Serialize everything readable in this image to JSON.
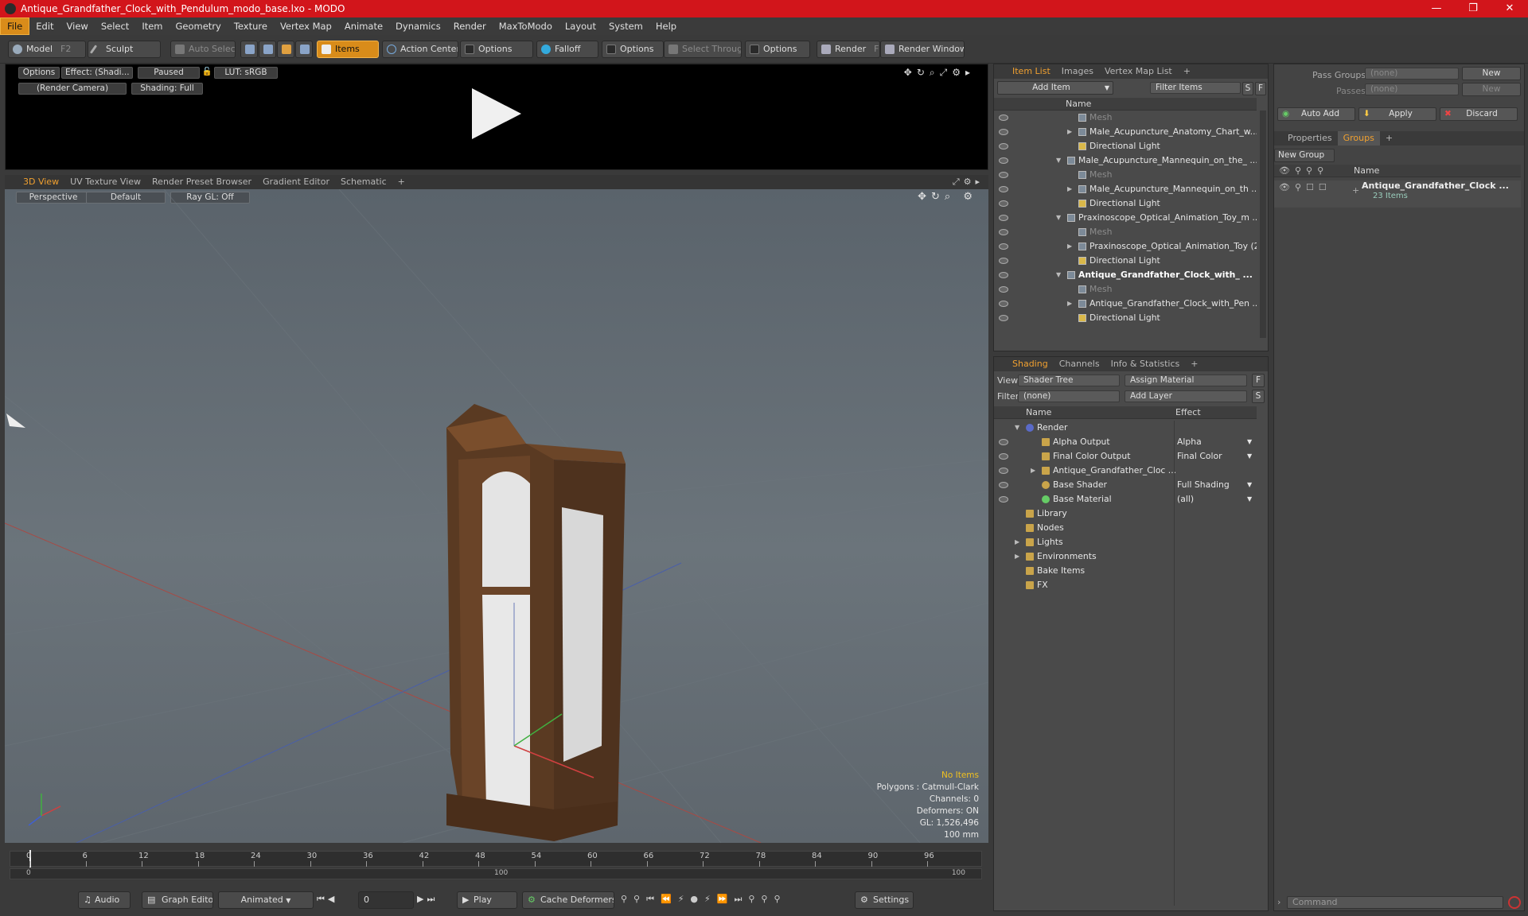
{
  "window": {
    "title": "Antique_Grandfather_Clock_with_Pendulum_modo_base.lxo - MODO"
  },
  "menu": [
    "File",
    "Edit",
    "View",
    "Select",
    "Item",
    "Geometry",
    "Texture",
    "Vertex Map",
    "Animate",
    "Dynamics",
    "Render",
    "MaxToModo",
    "Layout",
    "System",
    "Help"
  ],
  "toolbar": {
    "model": "Model",
    "model_key": "F2",
    "sculpt": "Sculpt",
    "auto_select": "Auto Select",
    "items": "Items",
    "action_center": "Action Center",
    "options1": "Options",
    "falloff": "Falloff",
    "options2": "Options",
    "select_through": "Select Through",
    "options3": "Options",
    "render": "Render",
    "render_key": "F9",
    "render_window": "Render Window"
  },
  "preview": {
    "options": "Options",
    "effect": "Effect: (Shadi...",
    "paused": "Paused",
    "lut": "LUT: sRGB",
    "camera": "(Render Camera)",
    "shading": "Shading: Full"
  },
  "viewport_tabs": [
    "3D View",
    "UV Texture View",
    "Render Preset Browser",
    "Gradient Editor",
    "Schematic",
    "+"
  ],
  "viewport": {
    "perspective": "Perspective",
    "default": "Default",
    "raygl": "Ray GL: Off",
    "stats": [
      "No Items",
      "Polygons : Catmull-Clark",
      "Channels: 0",
      "Deformers: ON",
      "GL: 1,526,496",
      "100 mm"
    ]
  },
  "timeline": {
    "ticks": [
      "0",
      "6",
      "12",
      "18",
      "24",
      "30",
      "36",
      "42",
      "48",
      "54",
      "60",
      "66",
      "72",
      "78",
      "84",
      "90",
      "96"
    ],
    "sub": [
      "0",
      "100",
      "100"
    ]
  },
  "bottom": {
    "audio": "Audio",
    "graph_editor": "Graph Editor",
    "animated": "Animated",
    "frame": "0",
    "play": "Play",
    "cache": "Cache Deformers",
    "settings": "Settings",
    "command_placeholder": "Command"
  },
  "item_list": {
    "tabs": [
      "Item List",
      "Images",
      "Vertex Map List",
      "+"
    ],
    "add_item": "Add Item",
    "filter": "Filter Items",
    "s": "S",
    "f": "F",
    "col_name": "Name",
    "rows": [
      {
        "label": "Mesh",
        "indent": 2,
        "dim": true
      },
      {
        "label": "Male_Acupuncture_Anatomy_Chart_w...",
        "indent": 2,
        "arrow": "▶"
      },
      {
        "label": "Directional Light",
        "indent": 2
      },
      {
        "label": "Male_Acupuncture_Mannequin_on_the_ ...",
        "indent": 1,
        "arrow": "▼"
      },
      {
        "label": "Mesh",
        "indent": 2,
        "dim": true
      },
      {
        "label": "Male_Acupuncture_Mannequin_on_th ...",
        "indent": 2,
        "arrow": "▶"
      },
      {
        "label": "Directional Light",
        "indent": 2
      },
      {
        "label": "Praxinoscope_Optical_Animation_Toy_m ...",
        "indent": 1,
        "arrow": "▼"
      },
      {
        "label": "Mesh",
        "indent": 2,
        "dim": true
      },
      {
        "label": "Praxinoscope_Optical_Animation_Toy (2)",
        "indent": 2,
        "arrow": "▶"
      },
      {
        "label": "Directional Light",
        "indent": 2
      },
      {
        "label": "Antique_Grandfather_Clock_with_ ...",
        "indent": 1,
        "arrow": "▼",
        "bold": true
      },
      {
        "label": "Mesh",
        "indent": 2,
        "dim": true
      },
      {
        "label": "Antique_Grandfather_Clock_with_Pen ...",
        "indent": 2,
        "arrow": "▶"
      },
      {
        "label": "Directional Light",
        "indent": 2
      }
    ]
  },
  "shading": {
    "tabs": [
      "Shading",
      "Channels",
      "Info & Statistics",
      "+"
    ],
    "view_label": "View",
    "view_value": "Shader Tree",
    "assign": "Assign Material",
    "f": "F",
    "filter_label": "Filter",
    "filter_value": "(none)",
    "add_layer": "Add Layer",
    "s": "S",
    "col_name": "Name",
    "col_effect": "Effect",
    "rows": [
      {
        "label": "Render",
        "effect": "",
        "indent": 0,
        "arrow": "▼"
      },
      {
        "label": "Alpha Output",
        "effect": "Alpha",
        "indent": 1
      },
      {
        "label": "Final Color Output",
        "effect": "Final Color",
        "indent": 1
      },
      {
        "label": "Antique_Grandfather_Cloc ...",
        "effect": "",
        "indent": 1,
        "arrow": "▶"
      },
      {
        "label": "Base Shader",
        "effect": "Full Shading",
        "indent": 1
      },
      {
        "label": "Base Material",
        "effect": "(all)",
        "indent": 1
      },
      {
        "label": "Library",
        "effect": "",
        "indent": 0
      },
      {
        "label": "Nodes",
        "effect": "",
        "indent": 0
      },
      {
        "label": "Lights",
        "effect": "",
        "indent": 0,
        "arrow": "▶"
      },
      {
        "label": "Environments",
        "effect": "",
        "indent": 0,
        "arrow": "▶"
      },
      {
        "label": "Bake Items",
        "effect": "",
        "indent": 0
      },
      {
        "label": "FX",
        "effect": "",
        "indent": 0
      }
    ]
  },
  "groups": {
    "pass_groups": "Pass Groups",
    "passes": "Passes",
    "none": "(none)",
    "new": "New",
    "auto_add": "Auto Add",
    "apply": "Apply",
    "discard": "Discard",
    "tabs": [
      "Properties",
      "Groups",
      "+"
    ],
    "new_group": "New Group",
    "col_name": "Name",
    "item": "Antique_Grandfather_Clock ...",
    "item_count": "23 Items"
  }
}
